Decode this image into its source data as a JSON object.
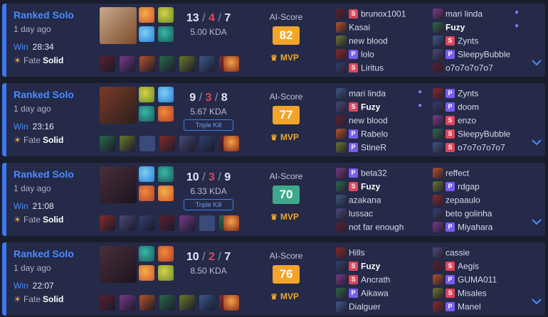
{
  "colors": {
    "score_gold": "#f3a42a",
    "score_green": "#3ea88c",
    "win_blue": "#4a8cff",
    "deaths_red": "#e0455a",
    "mvp_gold": "#f2a623"
  },
  "labels": {
    "ai_score": "AI-Score",
    "mvp": "MVP",
    "fate": "Fate"
  },
  "matches": [
    {
      "queue": "Ranked Solo",
      "ago": "1 day ago",
      "result": "Win",
      "duration": "28:34",
      "fate_value": "Solid",
      "kills": "13",
      "deaths": "4",
      "assists": "7",
      "kda_ratio": "5.00 KDA",
      "multi_kill": "",
      "score": "82",
      "score_color": "gold",
      "mvp": true,
      "team1": [
        {
          "name": "brunox1001",
          "tag": "S",
          "me": false,
          "duo": false
        },
        {
          "name": "Kasai",
          "tag": "",
          "me": false,
          "duo": false
        },
        {
          "name": "new blood",
          "tag": "",
          "me": false,
          "duo": false
        },
        {
          "name": "lolo",
          "tag": "P",
          "me": false,
          "duo": false
        },
        {
          "name": "Liritus",
          "tag": "S",
          "me": false,
          "duo": false
        }
      ],
      "team2": [
        {
          "name": "mari linda",
          "tag": "",
          "me": false,
          "duo": true
        },
        {
          "name": "Fuzy",
          "tag": "",
          "me": true,
          "duo": true
        },
        {
          "name": "Zynts",
          "tag": "S",
          "me": false,
          "duo": false
        },
        {
          "name": "SleepyBubble",
          "tag": "P",
          "me": false,
          "duo": false
        },
        {
          "name": "o7o7o7o7o7",
          "tag": "",
          "me": false,
          "duo": false
        }
      ]
    },
    {
      "queue": "Ranked Solo",
      "ago": "1 day ago",
      "result": "Win",
      "duration": "23:16",
      "fate_value": "Solid",
      "kills": "9",
      "deaths": "3",
      "assists": "8",
      "kda_ratio": "5.67 KDA",
      "multi_kill": "Triple Kill",
      "score": "77",
      "score_color": "gold",
      "mvp": true,
      "team1": [
        {
          "name": "mari linda",
          "tag": "",
          "me": false,
          "duo": true
        },
        {
          "name": "Fuzy",
          "tag": "S",
          "me": true,
          "duo": true
        },
        {
          "name": "new blood",
          "tag": "",
          "me": false,
          "duo": false
        },
        {
          "name": "Rabelo",
          "tag": "P",
          "me": false,
          "duo": false
        },
        {
          "name": "StineR",
          "tag": "P",
          "me": false,
          "duo": false
        }
      ],
      "team2": [
        {
          "name": "Zynts",
          "tag": "P",
          "me": false,
          "duo": false
        },
        {
          "name": "doom",
          "tag": "P",
          "me": false,
          "duo": false
        },
        {
          "name": "enzo",
          "tag": "S",
          "me": false,
          "duo": false
        },
        {
          "name": "SleepyBubble",
          "tag": "S",
          "me": false,
          "duo": false
        },
        {
          "name": "o7o7o7o7o7",
          "tag": "S",
          "me": false,
          "duo": false
        }
      ]
    },
    {
      "queue": "Ranked Solo",
      "ago": "1 day ago",
      "result": "Win",
      "duration": "21:08",
      "fate_value": "Solid",
      "kills": "10",
      "deaths": "3",
      "assists": "9",
      "kda_ratio": "6.33 KDA",
      "multi_kill": "Triple Kill",
      "score": "70",
      "score_color": "green",
      "mvp": true,
      "team1": [
        {
          "name": "beta32",
          "tag": "P",
          "me": false,
          "duo": false
        },
        {
          "name": "Fuzy",
          "tag": "S",
          "me": true,
          "duo": false
        },
        {
          "name": "azakana",
          "tag": "",
          "me": false,
          "duo": false
        },
        {
          "name": "lussac",
          "tag": "",
          "me": false,
          "duo": false
        },
        {
          "name": "not far enough",
          "tag": "",
          "me": false,
          "duo": false
        }
      ],
      "team2": [
        {
          "name": "reffect",
          "tag": "",
          "me": false,
          "duo": false
        },
        {
          "name": "rdgap",
          "tag": "P",
          "me": false,
          "duo": false
        },
        {
          "name": "zepaaulo",
          "tag": "",
          "me": false,
          "duo": false
        },
        {
          "name": "beto golinha",
          "tag": "",
          "me": false,
          "duo": false
        },
        {
          "name": "Miyahara",
          "tag": "P",
          "me": false,
          "duo": false
        }
      ]
    },
    {
      "queue": "Ranked Solo",
      "ago": "1 day ago",
      "result": "Win",
      "duration": "22:07",
      "fate_value": "Solid",
      "kills": "10",
      "deaths": "2",
      "assists": "7",
      "kda_ratio": "8.50 KDA",
      "multi_kill": "",
      "score": "76",
      "score_color": "gold",
      "mvp": true,
      "team1": [
        {
          "name": "Hills",
          "tag": "",
          "me": false,
          "duo": false
        },
        {
          "name": "Fuzy",
          "tag": "S",
          "me": true,
          "duo": false
        },
        {
          "name": "Ancrath",
          "tag": "S",
          "me": false,
          "duo": false
        },
        {
          "name": "Aikawa",
          "tag": "P",
          "me": false,
          "duo": false
        },
        {
          "name": "Dialguer",
          "tag": "",
          "me": false,
          "duo": false
        }
      ],
      "team2": [
        {
          "name": "cassie",
          "tag": "",
          "me": false,
          "duo": false
        },
        {
          "name": "Aegis",
          "tag": "S",
          "me": false,
          "duo": false
        },
        {
          "name": "GUMA011",
          "tag": "P",
          "me": false,
          "duo": false
        },
        {
          "name": "Misales",
          "tag": "S",
          "me": false,
          "duo": false
        },
        {
          "name": "Manel",
          "tag": "P",
          "me": false,
          "duo": false
        }
      ]
    }
  ]
}
